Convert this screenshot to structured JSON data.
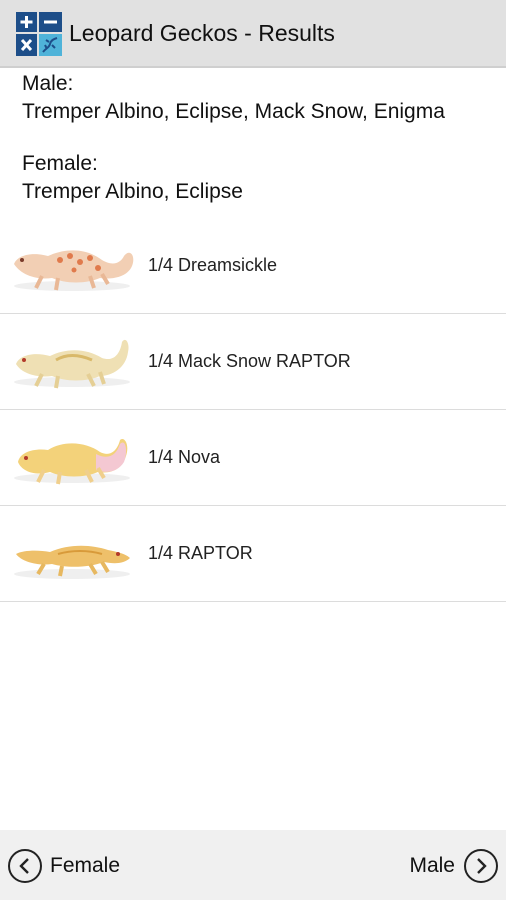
{
  "header": {
    "title": "Leopard Geckos - Results",
    "app_icon": "calculator-gecko-icon",
    "accent_color": "#1d4e89"
  },
  "parents": {
    "male_label": "Male:",
    "male_traits": "Tremper Albino, Eclipse, Mack Snow, Enigma",
    "female_label": "Female:",
    "female_traits": "Tremper Albino, Eclipse"
  },
  "results": [
    {
      "label": "1/4 Dreamsickle",
      "image": "gecko-dreamsickle-icon"
    },
    {
      "label": "1/4 Mack Snow RAPTOR",
      "image": "gecko-mack-snow-raptor-icon"
    },
    {
      "label": "1/4 Nova",
      "image": "gecko-nova-icon"
    },
    {
      "label": "1/4 RAPTOR",
      "image": "gecko-raptor-icon"
    }
  ],
  "footer": {
    "prev_label": "Female",
    "next_label": "Male",
    "prev_icon": "chevron-left-circle-icon",
    "next_icon": "chevron-right-circle-icon"
  }
}
